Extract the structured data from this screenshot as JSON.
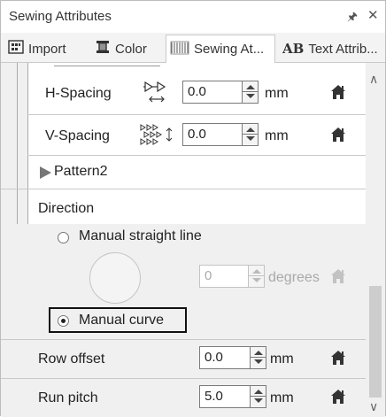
{
  "panel": {
    "title": "Sewing Attributes",
    "pin_icon": "pin-icon",
    "close_icon": "close-icon"
  },
  "tabs": [
    {
      "label": "Import",
      "icon": "import-grid-icon"
    },
    {
      "label": "Color",
      "icon": "color-spool-icon"
    },
    {
      "label": "Sewing At...",
      "icon": "sewing-stitch-icon",
      "active": true
    },
    {
      "label": "Text Attrib...",
      "icon": "text-ab-icon"
    }
  ],
  "spacing": {
    "h_label": "H-Spacing",
    "h_value": "0.0",
    "h_unit": "mm",
    "v_label": "V-Spacing",
    "v_value": "0.0",
    "v_unit": "mm"
  },
  "pattern": {
    "label": "Pattern2"
  },
  "direction": {
    "label": "Direction",
    "option_straight": "Manual straight line",
    "straight_selected": false,
    "degrees_value": "0",
    "degrees_unit": "degrees",
    "option_curve": "Manual curve",
    "curve_selected": true
  },
  "row_offset": {
    "label": "Row offset",
    "value": "0.0",
    "unit": "mm"
  },
  "run_pitch": {
    "label": "Run pitch",
    "value": "5.0",
    "unit": "mm"
  },
  "colors": {
    "panel_bg": "#f0f0f0",
    "highlight_border": "#111111",
    "disabled_text": "#a9a9a9"
  }
}
